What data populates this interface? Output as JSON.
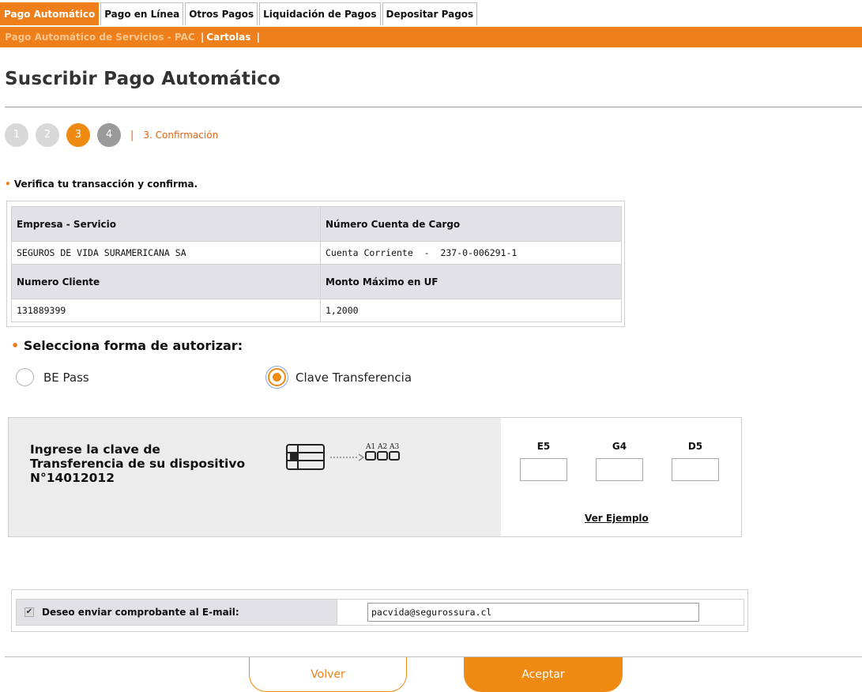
{
  "nav": {
    "tabs": [
      {
        "label": "Pago Automático",
        "active": true
      },
      {
        "label": "Pago en Línea",
        "active": false
      },
      {
        "label": "Otros Pagos",
        "active": false
      },
      {
        "label": "Liquidación de Pagos",
        "active": false
      },
      {
        "label": "Depositar Pagos",
        "active": false
      }
    ],
    "sub": {
      "pac": "Pago Automático de Servicios - PAC",
      "sep1": "|",
      "cartolas": "Cartolas",
      "sep2": "|"
    }
  },
  "page": {
    "title": "Suscribir Pago Automático"
  },
  "steps": {
    "items": [
      "1",
      "2",
      "3",
      "4"
    ],
    "current": "3",
    "separator": "|",
    "label": "3. Confirmación"
  },
  "verify": {
    "bullet": "•",
    "text": "Verifica tu transacción y confirma."
  },
  "detail": {
    "empresa_header": "Empresa - Servicio",
    "cuenta_header": "Número Cuenta de Cargo",
    "empresa_value": "SEGUROS DE VIDA SURAMERICANA SA",
    "cuenta_value": "Cuenta Corriente  -  237-0-006291-1",
    "cliente_header": "Numero Cliente",
    "monto_header": "Monto Máximo en UF",
    "cliente_value": "131889399",
    "monto_value": "1,2000"
  },
  "auth": {
    "bullet": "•",
    "title": "Selecciona forma de autorizar:",
    "option_bepass": "BE Pass",
    "option_clave": "Clave Transferencia",
    "selected": "Clave Transferencia"
  },
  "key": {
    "instruction_1": "Ingrese la clave de",
    "instruction_2": "Transferencia de su dispositivo",
    "instruction_3": "N°14012012",
    "card_labels": [
      "A1",
      "A2",
      "A3"
    ],
    "coords": [
      "E5",
      "G4",
      "D5"
    ],
    "ver_ejemplo": "Ver Ejemplo"
  },
  "email": {
    "checked": true,
    "check_glyph": "✔",
    "label": "Deseo enviar comprobante al E-mail:",
    "value": "pacvida@segurossura.cl"
  },
  "buttons": {
    "volver": "Volver",
    "aceptar": "Aceptar"
  },
  "colors": {
    "accent": "#ef7f1a",
    "step_label": "#e56410",
    "header_bg": "#e1e1e6",
    "panel_bg": "#ececec"
  }
}
